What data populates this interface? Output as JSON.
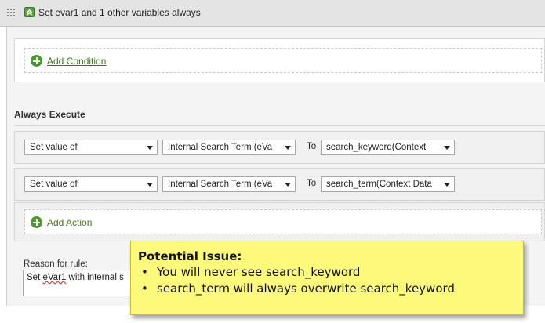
{
  "rule": {
    "title": "Set evar1 and 1 other variables always",
    "add_condition_label": "Add Condition"
  },
  "always_execute": {
    "label": "Always Execute",
    "actions": [
      {
        "operation": "Set value of",
        "variable": "Internal Search Term (eVa",
        "to_label": "To",
        "value": "search_keyword(Context"
      },
      {
        "operation": "Set value of",
        "variable": "Internal Search Term (eVa",
        "to_label": "To",
        "value": "search_term(Context Data"
      }
    ],
    "add_action_label": "Add Action"
  },
  "reason": {
    "label": "Reason for rule:",
    "value_prefix": "Set ",
    "value_misspelled": "eVar1",
    "value_suffix": " with internal s"
  },
  "callout": {
    "title": "Potential Issue:",
    "items": [
      "You will never see search_keyword",
      "search_term will always overwrite search_keyword"
    ]
  },
  "colors": {
    "accent_green": "#4a9a2a",
    "callout_bg": "#fdf97a",
    "header_bg": "#e4e4e4"
  },
  "icons": [
    "drag-handle-icon",
    "collapse-icon",
    "plus-circle-icon",
    "chevron-down-icon"
  ]
}
